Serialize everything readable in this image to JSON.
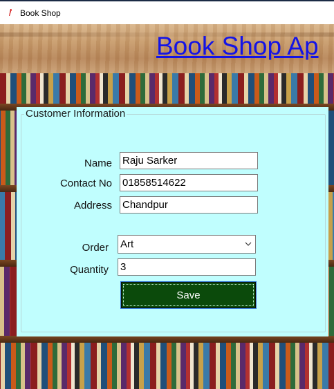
{
  "window": {
    "title": "Book Shop"
  },
  "header": {
    "heading": "Book Shop Ap"
  },
  "form": {
    "group_title": "Customer Information",
    "name_label": "Name",
    "name_value": "Raju Sarker",
    "contact_label": "Contact No",
    "contact_value": "01858514622",
    "address_label": "Address",
    "address_value": "Chandpur",
    "order_label": "Order",
    "order_value": "Art",
    "quantity_label": "Quantity",
    "quantity_value": "3",
    "save_label": "Save"
  },
  "colors": {
    "panel": "#c0fefe",
    "heading": "#1414e6",
    "save_button": "#0b4a0b"
  }
}
